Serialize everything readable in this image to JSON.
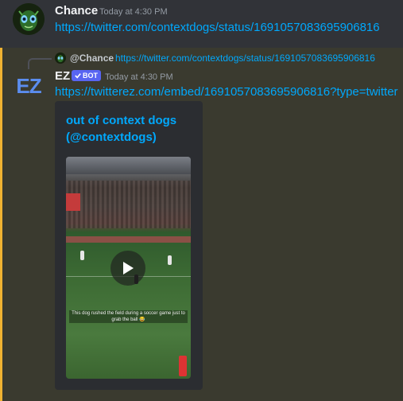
{
  "message1": {
    "author": "Chance",
    "timestamp": "Today at 4:30 PM",
    "link": "https://twitter.com/contextdogs/status/1691057083695906816",
    "avatar_icon": "alien-face-icon"
  },
  "message2": {
    "reply": {
      "mention": "@Chance",
      "link": "https://twitter.com/contextdogs/status/1691057083695906816"
    },
    "author": "EZ",
    "bot_tag": "BOT",
    "timestamp": "Today at 4:30 PM",
    "link": "https://twitterez.com/embed/1691057083695906816?type=twitter",
    "avatar_text": "EZ",
    "embed": {
      "title": "out of context dogs (@contextdogs)",
      "video_caption": "This dog rushed the field during a soccer game just to grab the ball 😂",
      "play_icon": "play-icon"
    }
  },
  "colors": {
    "background": "#313338",
    "highlight_background": "#3a3a2f",
    "mention_bar": "#f0b232",
    "link": "#00a8fc",
    "bot_tag": "#5865f2",
    "embed_background": "#2b2d31"
  }
}
